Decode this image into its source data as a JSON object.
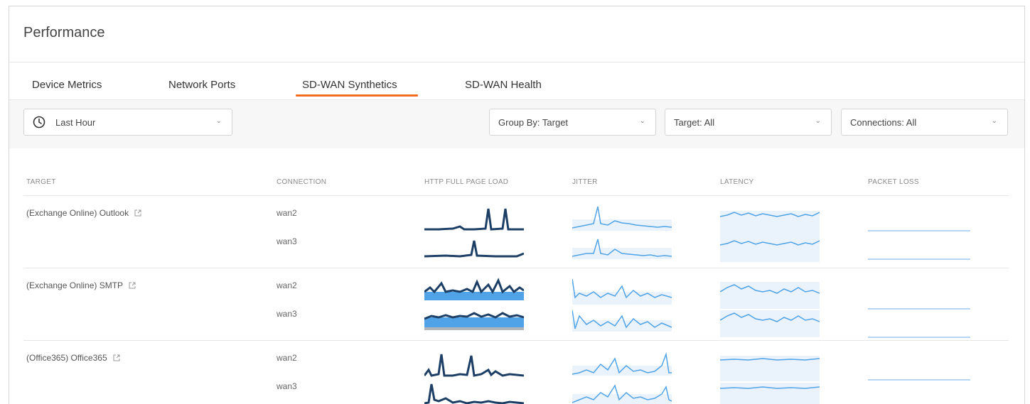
{
  "page": {
    "title": "Performance"
  },
  "tabs": [
    {
      "label": "Device Metrics",
      "active": false
    },
    {
      "label": "Network Ports",
      "active": false
    },
    {
      "label": "SD-WAN Synthetics",
      "active": true
    },
    {
      "label": "SD-WAN Health",
      "active": false
    }
  ],
  "filters": {
    "time": {
      "value": "Last Hour",
      "icon": "clock-icon"
    },
    "group_by": "Group By: Target",
    "target": "Target: All",
    "connections": "Connections: All"
  },
  "table": {
    "columns": [
      "TARGET",
      "CONNECTION",
      "HTTP FULL PAGE LOAD",
      "JITTER",
      "LATENCY",
      "PACKET LOSS"
    ],
    "rows": [
      {
        "target": "(Exchange Online) Outlook",
        "connections": [
          "wan2",
          "wan3"
        ]
      },
      {
        "target": "(Exchange Online) SMTP",
        "connections": [
          "wan2",
          "wan3"
        ]
      },
      {
        "target": "(Office365) Office365",
        "connections": [
          "wan2",
          "wan3"
        ]
      }
    ]
  },
  "colors": {
    "accent": "#f26b21",
    "chart_dark": "#1d3f66",
    "chart_light": "#4fa3e6",
    "chart_band": "#eaf3fc"
  }
}
